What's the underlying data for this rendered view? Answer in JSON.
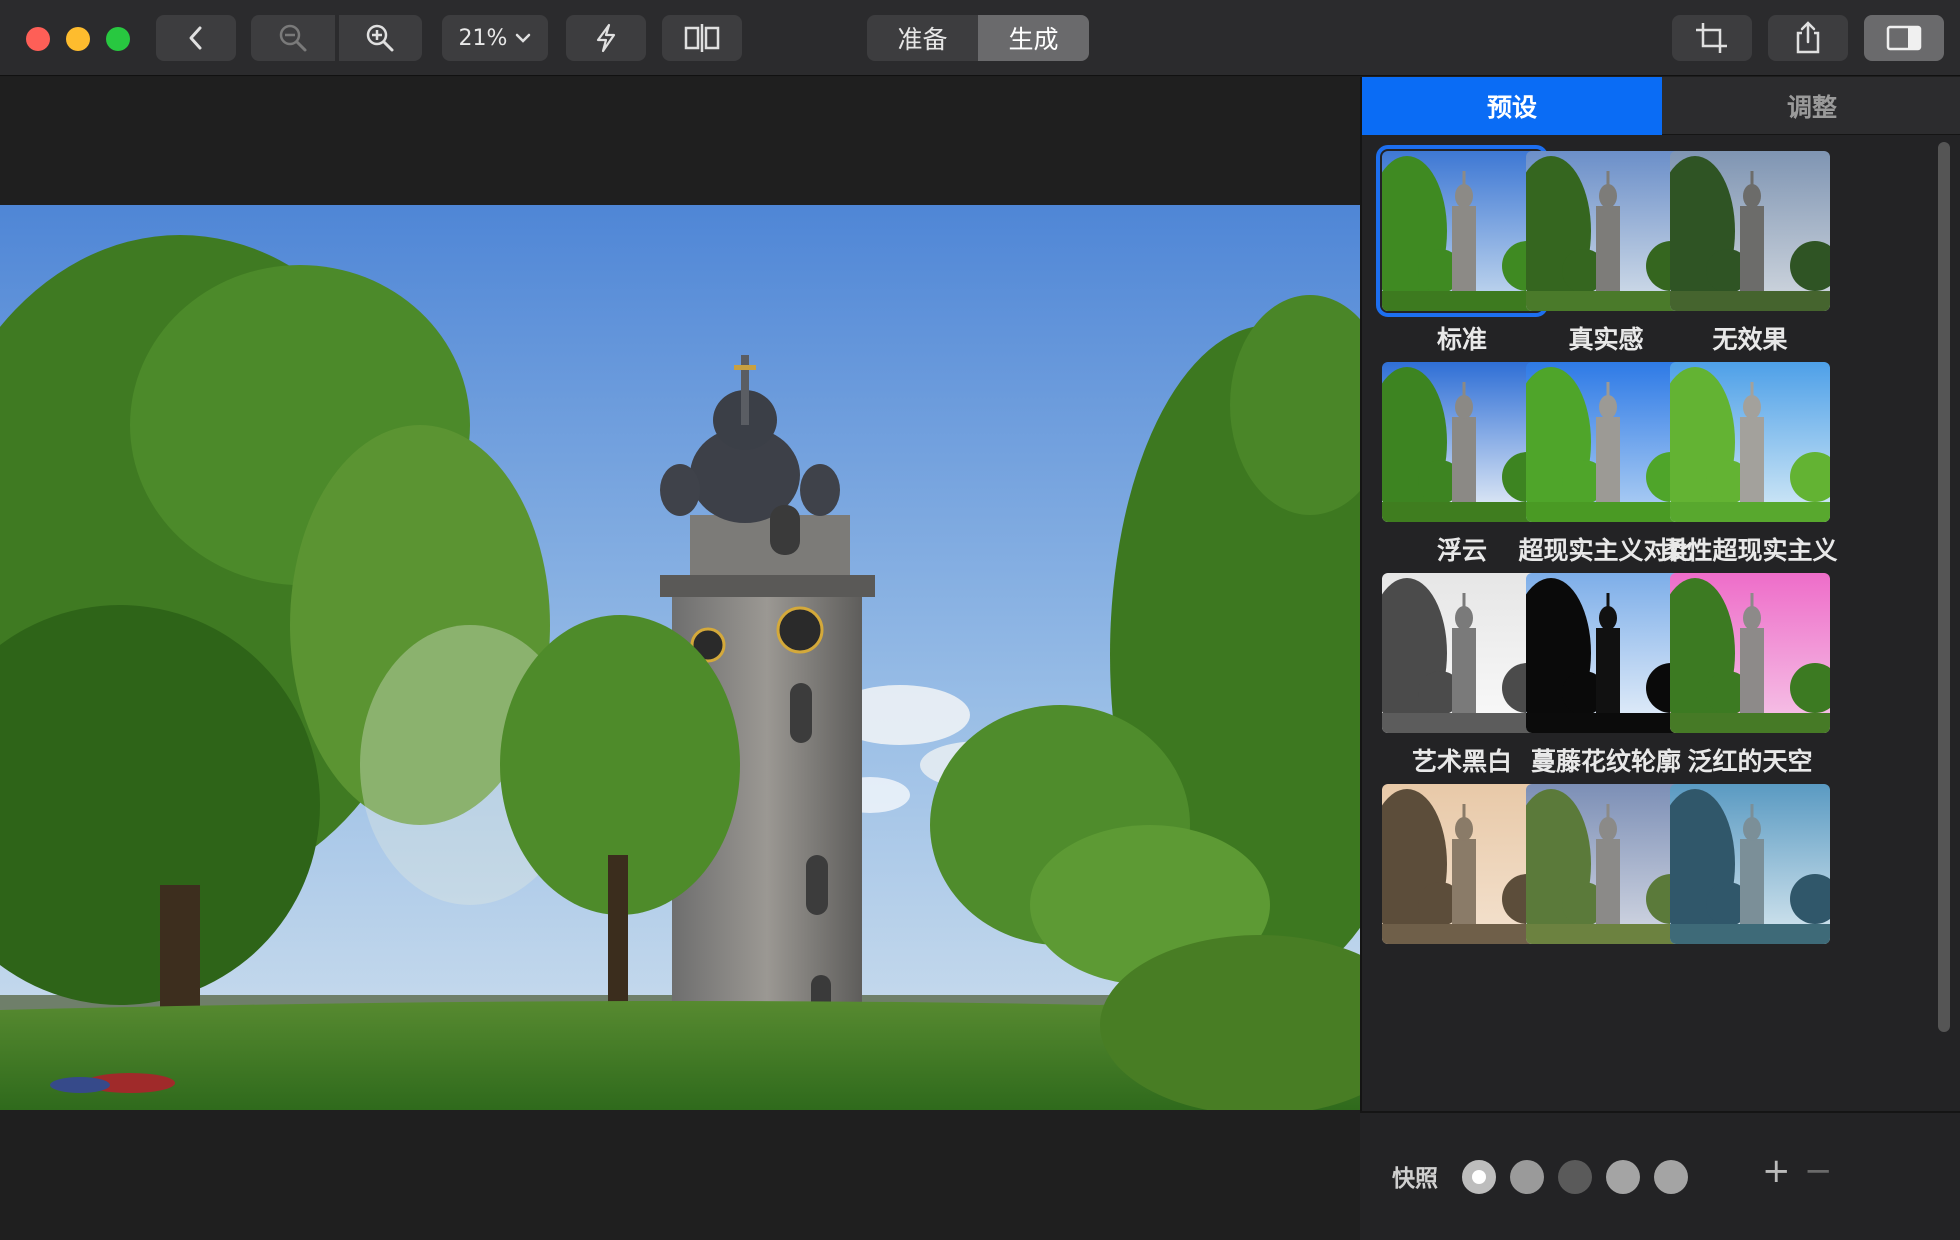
{
  "toolbar": {
    "zoom_level": "21%",
    "mode_prepare": "准备",
    "mode_generate": "生成"
  },
  "panel": {
    "tab_presets": "预设",
    "tab_adjust": "调整",
    "presets": [
      {
        "label": "标准",
        "style": "standard"
      },
      {
        "label": "真实感",
        "style": "realistic"
      },
      {
        "label": "无效果",
        "style": "none"
      },
      {
        "label": "浮云",
        "style": "cloud"
      },
      {
        "label": "超现实主义对比",
        "style": "surreal"
      },
      {
        "label": "柔性超现实主义",
        "style": "soft-surreal"
      },
      {
        "label": "艺术黑白",
        "style": "bw"
      },
      {
        "label": "蔓藤花纹轮廓",
        "style": "silhouette"
      },
      {
        "label": "泛红的天空",
        "style": "pink-sky"
      },
      {
        "label": "",
        "style": "sepia"
      },
      {
        "label": "",
        "style": "faded"
      },
      {
        "label": "",
        "style": "cyan"
      }
    ]
  },
  "snapshots": {
    "label": "快照",
    "plus": "+",
    "minus": "−"
  },
  "colors": {
    "accent": "#0a6cf5",
    "toolbar_bg": "#2b2b2d",
    "panel_bg": "#232325"
  }
}
